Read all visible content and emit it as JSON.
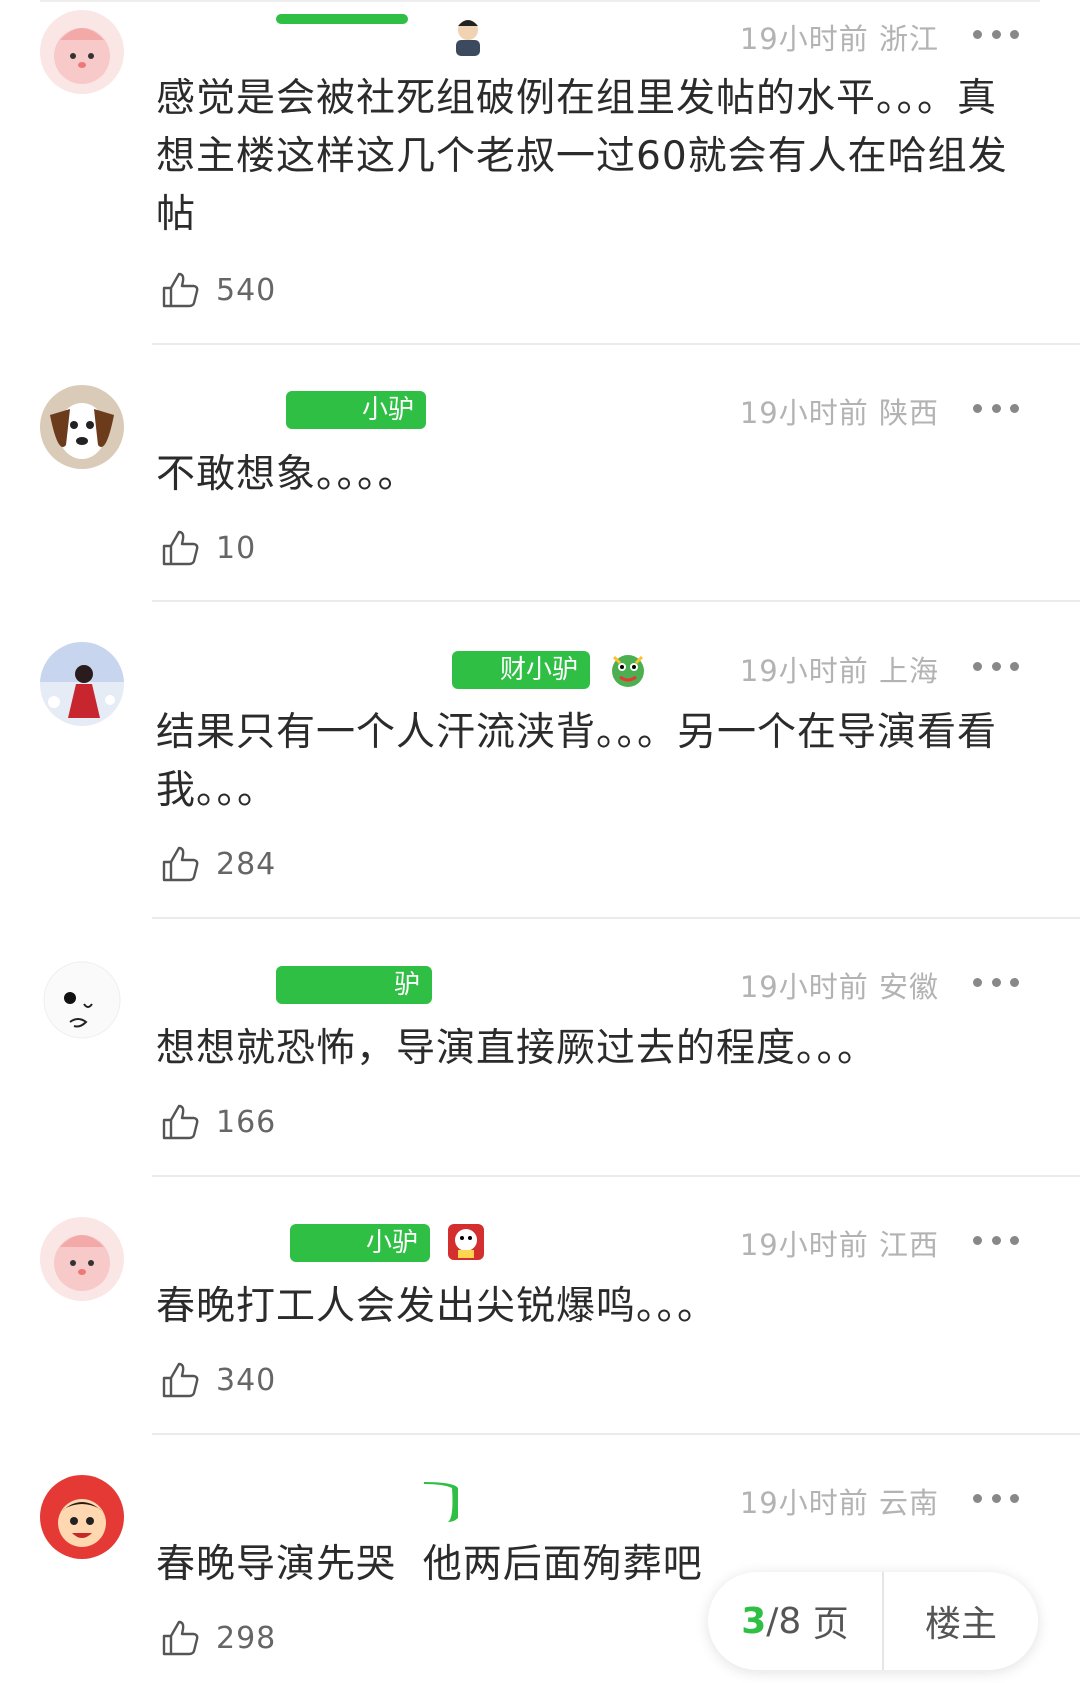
{
  "comments": [
    {
      "time": "19小时前",
      "region": "浙江",
      "text": "感觉是会被社死组破例在组里发帖的水平。。。真想主楼这样这几个老叔一过60就会有人在哈组发帖",
      "likes": "540",
      "badge": ""
    },
    {
      "time": "19小时前",
      "region": "陕西",
      "text": "不敢想象。。。。",
      "likes": "10",
      "badge": "小驴"
    },
    {
      "time": "19小时前",
      "region": "上海",
      "text": "结果只有一个人汗流浃背。。。另一个在导演看看我。。。",
      "likes": "284",
      "badge": "财小驴"
    },
    {
      "time": "19小时前",
      "region": "安徽",
      "text": "想想就恐怖，导演直接厥过去的程度。。。",
      "likes": "166",
      "badge": "驴"
    },
    {
      "time": "19小时前",
      "region": "江西",
      "text": "春晚打工人会发出尖锐爆鸣。。。",
      "likes": "340",
      "badge": "小驴"
    },
    {
      "time": "19小时前",
      "region": "云南",
      "text": "春晚导演先哭  他两后面殉葬吧",
      "likes": "298",
      "badge": ""
    }
  ],
  "pager": {
    "current": "3",
    "total": "/8",
    "unit": "页",
    "owner_label": "楼主"
  },
  "colors": {
    "accent": "#2fbf44",
    "meta": "#b3b3b3",
    "text": "#2b2b2b"
  },
  "icons": {
    "like": "thumbs-up-icon",
    "more": "more-dots-icon"
  }
}
